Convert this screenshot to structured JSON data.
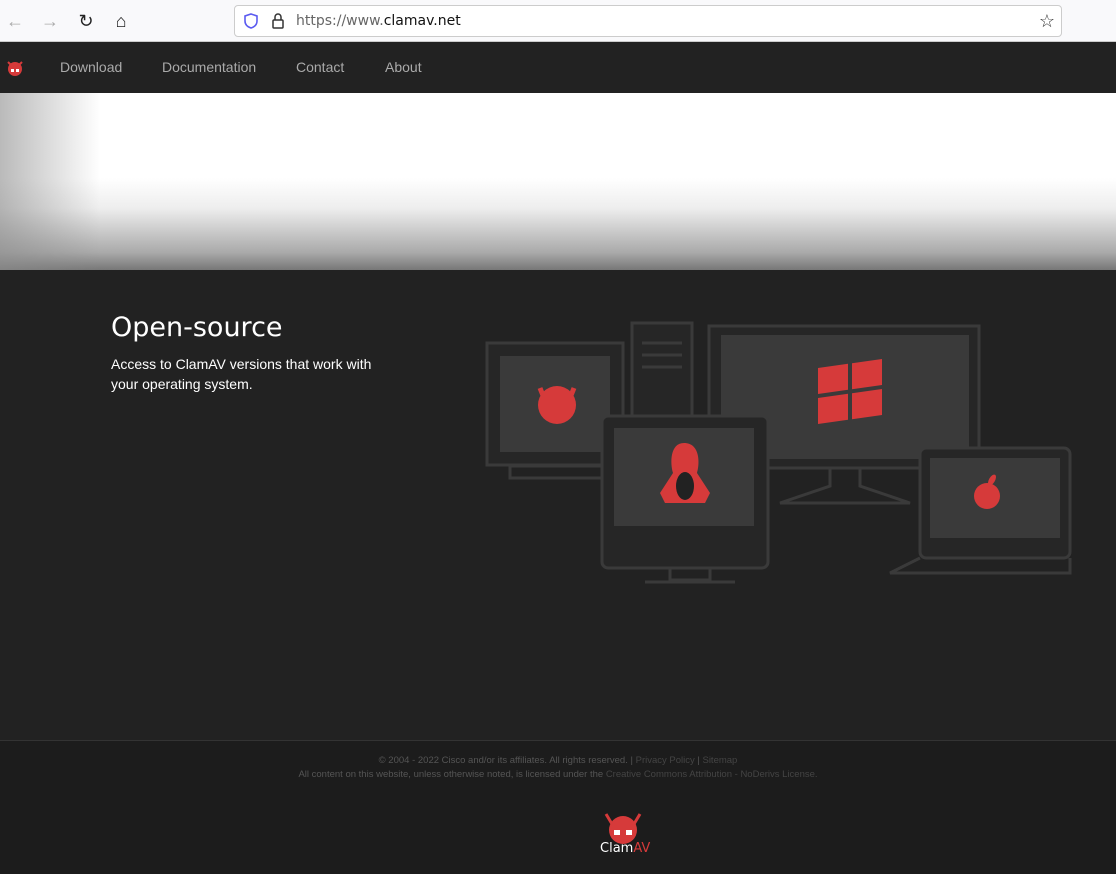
{
  "browser": {
    "url_prefix": "https://www.",
    "url_domain": "clamav.net",
    "icons": [
      "back-arrow-icon",
      "forward-arrow-icon",
      "reload-icon",
      "home-icon",
      "shield-icon",
      "lock-icon",
      "star-icon"
    ]
  },
  "nav": {
    "items": [
      "Download",
      "Documentation",
      "Contact",
      "About"
    ]
  },
  "hero": {
    "title": "Open-source",
    "text": "Access to ClamAV versions that work with your operating system."
  },
  "footer": {
    "copyright": "© 2004 - 2022 Cisco and/or its affiliates. All rights reserved.",
    "sep": "|",
    "privacy": "Privacy Policy",
    "sitemap": "Sitemap",
    "license_text": "All content on this website, unless otherwise noted, is licensed under the",
    "license_link": "Creative Commons Attribution - NoDerivs License.",
    "logo_text": "ClamAV"
  },
  "colors": {
    "accent": "#d63a3a",
    "bg": "#222222"
  }
}
